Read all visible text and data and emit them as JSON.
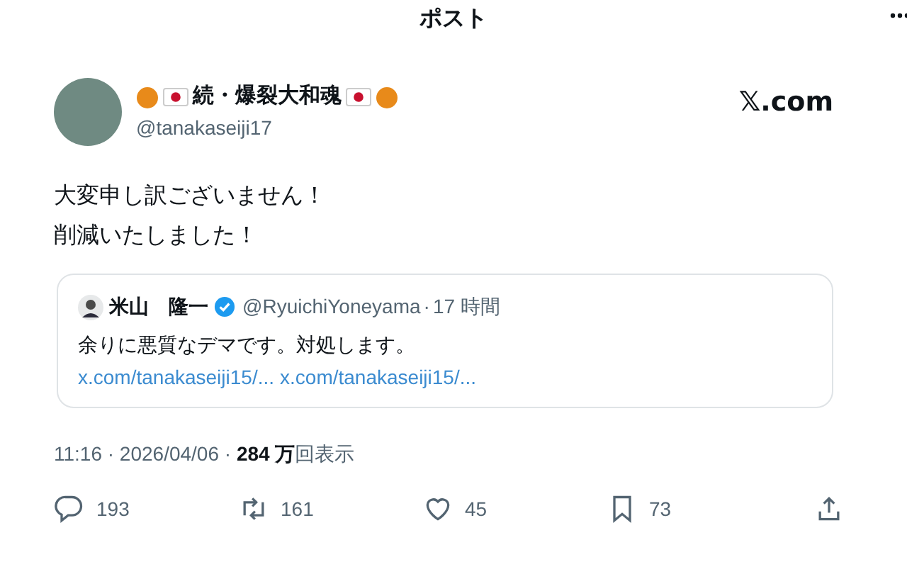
{
  "header": {
    "title": "ポスト"
  },
  "post": {
    "author": {
      "name": "続・爆裂大和魂",
      "handle": "@tanakaseiji17"
    },
    "source": "𝕏.com",
    "text": [
      "大変申し訳ございません！",
      "削減いたしました！"
    ],
    "quote": {
      "author": "米山　隆一",
      "verified": true,
      "handle": "@RyuichiYoneyama",
      "separator": "·",
      "time": "17 時間",
      "text": "余りに悪質なデマです。対処します。",
      "links": [
        "x.com/tanakaseiji15/...",
        "x.com/tanakaseiji15/..."
      ]
    },
    "meta": "11:16 · 2026/04/06 · **284 万**回表示",
    "actions": [
      {
        "kind": "reply",
        "count": "193"
      },
      {
        "kind": "repost",
        "count": "161"
      },
      {
        "kind": "like",
        "count": "45"
      },
      {
        "kind": "bookmark",
        "count": "73"
      },
      {
        "kind": "share"
      }
    ]
  }
}
